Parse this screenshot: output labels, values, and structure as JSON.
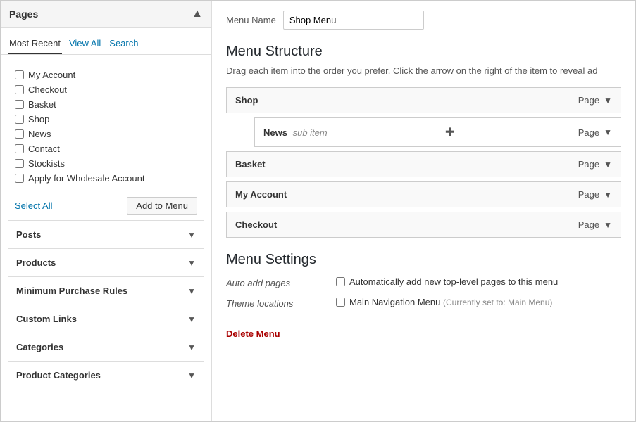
{
  "left_panel": {
    "title": "Pages",
    "tabs": [
      {
        "id": "most-recent",
        "label": "Most Recent",
        "active": true
      },
      {
        "id": "view-all",
        "label": "View All",
        "active": false
      },
      {
        "id": "search",
        "label": "Search",
        "active": false
      }
    ],
    "pages": [
      {
        "id": "my-account",
        "label": "My Account",
        "checked": false
      },
      {
        "id": "checkout",
        "label": "Checkout",
        "checked": false
      },
      {
        "id": "basket",
        "label": "Basket",
        "checked": false
      },
      {
        "id": "shop",
        "label": "Shop",
        "checked": false
      },
      {
        "id": "news",
        "label": "News",
        "checked": false
      },
      {
        "id": "contact",
        "label": "Contact",
        "checked": false
      },
      {
        "id": "stockists",
        "label": "Stockists",
        "checked": false
      },
      {
        "id": "apply-wholesale",
        "label": "Apply for Wholesale Account",
        "checked": false
      }
    ],
    "select_all_label": "Select All",
    "add_to_menu_label": "Add to Menu",
    "accordions": [
      {
        "id": "posts",
        "label": "Posts"
      },
      {
        "id": "products",
        "label": "Products"
      },
      {
        "id": "minimum-purchase-rules",
        "label": "Minimum Purchase Rules"
      },
      {
        "id": "custom-links",
        "label": "Custom Links"
      },
      {
        "id": "categories",
        "label": "Categories"
      },
      {
        "id": "product-categories",
        "label": "Product Categories"
      }
    ]
  },
  "right_panel": {
    "menu_name_label": "Menu Name",
    "menu_name_value": "Shop Menu",
    "menu_name_placeholder": "Shop Menu",
    "menu_structure_title": "Menu Structure",
    "drag_hint": "Drag each item into the order you prefer. Click the arrow on the right of the item to reveal ad",
    "menu_items": [
      {
        "id": "shop",
        "label": "Shop",
        "type": "Page",
        "level": 0
      },
      {
        "id": "news",
        "label": "News",
        "sub_label": "sub item",
        "type": "Page",
        "level": 1
      },
      {
        "id": "basket",
        "label": "Basket",
        "type": "Page",
        "level": 0
      },
      {
        "id": "my-account",
        "label": "My Account",
        "type": "Page",
        "level": 0
      },
      {
        "id": "checkout",
        "label": "Checkout",
        "type": "Page",
        "level": 0
      }
    ],
    "menu_settings_title": "Menu Settings",
    "settings": {
      "auto_add_label": "Auto add pages",
      "auto_add_text": "Automatically add new top-level pages to this menu",
      "theme_locations_label": "Theme locations",
      "theme_locations_text": "Main Navigation Menu",
      "theme_locations_note": "(Currently set to: Main Menu)"
    },
    "delete_menu_label": "Delete Menu"
  }
}
